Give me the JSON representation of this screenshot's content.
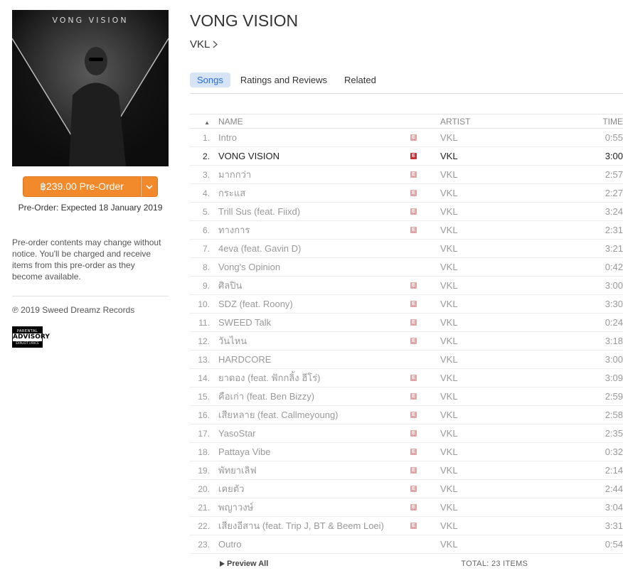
{
  "album": {
    "cover_title": "VONG VISION",
    "title": "VONG VISION",
    "artist": "VKL"
  },
  "purchase": {
    "button_label": "฿239.00 Pre-Order",
    "preorder_note": "Pre-Order: Expected 18 January 2019",
    "preorder_info": "Pre-order contents may change without notice. You'll be charged and receive items from this pre-order as they become available.",
    "copyright": "℗ 2019 Sweed Dreamz Records"
  },
  "advisory": {
    "line1": "PARENTAL",
    "line2": "ADVISORY",
    "line3": "EXPLICIT LYRICS"
  },
  "tabs": [
    {
      "label": "Songs",
      "active": true
    },
    {
      "label": "Ratings and Reviews",
      "active": false
    },
    {
      "label": "Related",
      "active": false
    }
  ],
  "columns": {
    "name": "NAME",
    "artist": "ARTIST",
    "time": "TIME"
  },
  "explicit_badge": "E",
  "tracks": [
    {
      "num": "1.",
      "name": "Intro",
      "explicit": true,
      "artist": "VKL",
      "time": "0:55"
    },
    {
      "num": "2.",
      "name": "VONG VISION",
      "explicit": true,
      "artist": "VKL",
      "time": "3:00",
      "selected": true
    },
    {
      "num": "3.",
      "name": "มากกว่า",
      "explicit": true,
      "artist": "VKL",
      "time": "2:57"
    },
    {
      "num": "4.",
      "name": "กระแส",
      "explicit": true,
      "artist": "VKL",
      "time": "2:27"
    },
    {
      "num": "5.",
      "name": "Trill Sus (feat. Fiixd)",
      "explicit": true,
      "artist": "VKL",
      "time": "3:24"
    },
    {
      "num": "6.",
      "name": "ทางการ",
      "explicit": true,
      "artist": "VKL",
      "time": "2:31"
    },
    {
      "num": "7.",
      "name": "4eva (feat. Gavin D)",
      "explicit": false,
      "artist": "VKL",
      "time": "3:21"
    },
    {
      "num": "8.",
      "name": "Vong's Opinion",
      "explicit": false,
      "artist": "VKL",
      "time": "0:42"
    },
    {
      "num": "9.",
      "name": "ศิลปิน",
      "explicit": true,
      "artist": "VKL",
      "time": "3:00"
    },
    {
      "num": "10.",
      "name": "SDZ (feat. Roony)",
      "explicit": true,
      "artist": "VKL",
      "time": "3:30"
    },
    {
      "num": "11.",
      "name": "SWEED Talk",
      "explicit": true,
      "artist": "VKL",
      "time": "0:24"
    },
    {
      "num": "12.",
      "name": "วันไหน",
      "explicit": true,
      "artist": "VKL",
      "time": "3:18"
    },
    {
      "num": "13.",
      "name": "HARDCORE",
      "explicit": false,
      "artist": "VKL",
      "time": "3:00"
    },
    {
      "num": "14.",
      "name": "ยาดอง (feat. ฟักกลิ้ง ฮีโร่)",
      "explicit": true,
      "artist": "VKL",
      "time": "3:09"
    },
    {
      "num": "15.",
      "name": "คือเก่า (feat. Ben Bizzy)",
      "explicit": true,
      "artist": "VKL",
      "time": "2:59"
    },
    {
      "num": "16.",
      "name": "เสียหลาย (feat. Callmeyoung)",
      "explicit": true,
      "artist": "VKL",
      "time": "2:58"
    },
    {
      "num": "17.",
      "name": "YasoStar",
      "explicit": true,
      "artist": "VKL",
      "time": "2:35"
    },
    {
      "num": "18.",
      "name": "Pattaya Vibe",
      "explicit": true,
      "artist": "VKL",
      "time": "0:32"
    },
    {
      "num": "19.",
      "name": "พัทยาเลิฟ",
      "explicit": true,
      "artist": "VKL",
      "time": "2:14"
    },
    {
      "num": "20.",
      "name": "เคยตัว",
      "explicit": true,
      "artist": "VKL",
      "time": "2:44"
    },
    {
      "num": "21.",
      "name": "พญาวงษ์",
      "explicit": true,
      "artist": "VKL",
      "time": "3:04"
    },
    {
      "num": "22.",
      "name": "เสียงอีสาน (feat. Trip J, BT & Beem Loei)",
      "explicit": true,
      "artist": "VKL",
      "time": "3:31"
    },
    {
      "num": "23.",
      "name": "Outro",
      "explicit": false,
      "artist": "VKL",
      "time": "0:54"
    }
  ],
  "footer": {
    "preview_label": "Preview All",
    "total": "TOTAL: 23 ITEMS"
  },
  "colors": {
    "accent_orange": "#f28a2b",
    "tab_active_bg": "#d6e4f5",
    "tab_active_text": "#2a6fd6",
    "explicit_badge": "#e2a3a5",
    "explicit_badge_selected": "#cc2a33"
  }
}
